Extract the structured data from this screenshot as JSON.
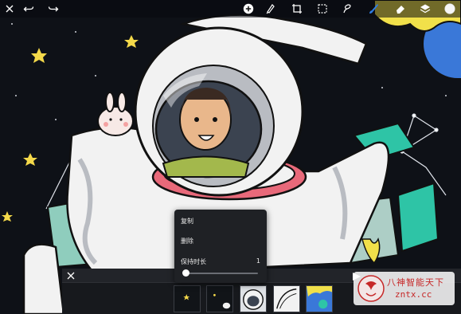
{
  "toolbar": {
    "left": [
      "close-icon",
      "undo-icon",
      "redo-icon"
    ],
    "center": [
      "add-icon",
      "adjust-icon",
      "transform-icon",
      "select-icon",
      "liquify-icon"
    ],
    "right": [
      "brush-icon",
      "eraser-icon",
      "layers-icon"
    ],
    "active_color": "#2f7fe8"
  },
  "context_menu": {
    "copy_label": "复制",
    "delete_label": "删除",
    "hold_label": "保持时长",
    "hold_value": "1",
    "hold_fraction": 0.0
  },
  "frame_strip": {
    "frames": [
      "frame-1",
      "frame-2",
      "frame-3",
      "frame-4",
      "frame-5"
    ]
  },
  "watermark": {
    "line1": "八神智能天下",
    "line2": "zntx.cc"
  },
  "colors": {
    "background": "#0e1117",
    "suit": "#f2f2f2",
    "suit_shadow": "#b9bcc2",
    "teal": "#2ec4a6",
    "planet_blue": "#3a78d8",
    "planet_yellow": "#f1e04a",
    "collar_pink": "#e8697a",
    "star_yellow": "#f4d94a"
  }
}
